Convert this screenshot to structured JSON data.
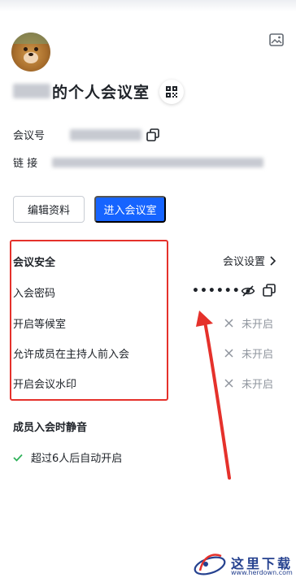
{
  "room": {
    "title_suffix": "的个人会议室"
  },
  "info": {
    "meeting_id_label": "会议号",
    "link_label": "链  接"
  },
  "actions": {
    "edit_label": "编辑资料",
    "enter_label": "进入会议室"
  },
  "security": {
    "title": "会议安全",
    "settings_label": "会议设置",
    "password_label": "入会密码",
    "password_mask": "••••••",
    "rows": [
      {
        "label": "开启等候室",
        "status": "未开启"
      },
      {
        "label": "允许成员在主持人前入会",
        "status": "未开启"
      },
      {
        "label": "开启会议水印",
        "status": "未开启"
      }
    ]
  },
  "mute": {
    "title": "成员入会时静音",
    "option": "超过6人后自动开启"
  },
  "watermark": {
    "brand": "这里下载",
    "url": "www.herdown.com"
  },
  "colors": {
    "accent": "#1664ff",
    "highlight_box": "#e5312b",
    "muted": "#8f959e",
    "check": "#2fb25a"
  }
}
